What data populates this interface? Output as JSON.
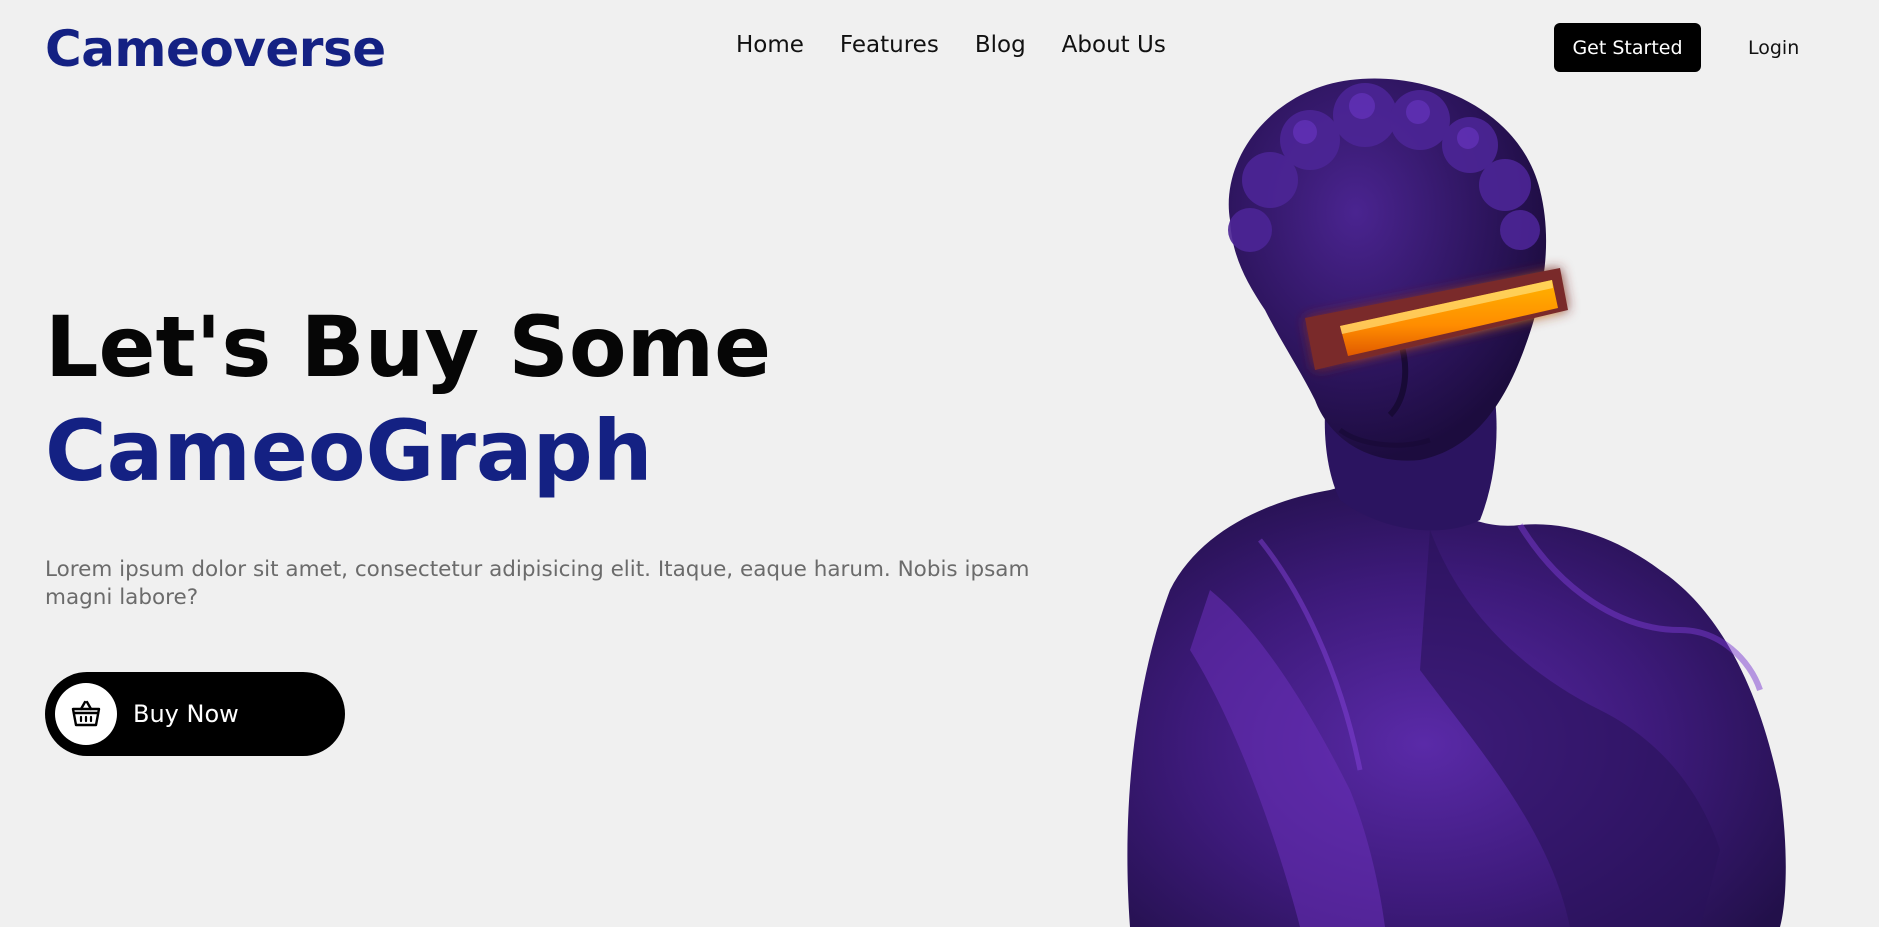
{
  "header": {
    "logo": "Cameoverse",
    "nav": [
      "Home",
      "Features",
      "Blog",
      "About Us"
    ],
    "get_started": "Get Started",
    "login": "Login"
  },
  "hero": {
    "headline_line1": "Let's Buy Some",
    "headline_line2": "CameoGraph",
    "description": "Lorem ipsum dolor sit amet, consectetur adipisicing elit. Itaque, eaque harum. Nobis ipsam magni labore?",
    "buy_button": "Buy Now",
    "buy_icon": "basket-icon"
  },
  "colors": {
    "brand": "#142183",
    "background": "#f0f0f0",
    "button": "#000000",
    "visor": "#ff9800",
    "statue": "#3a1a6e"
  }
}
